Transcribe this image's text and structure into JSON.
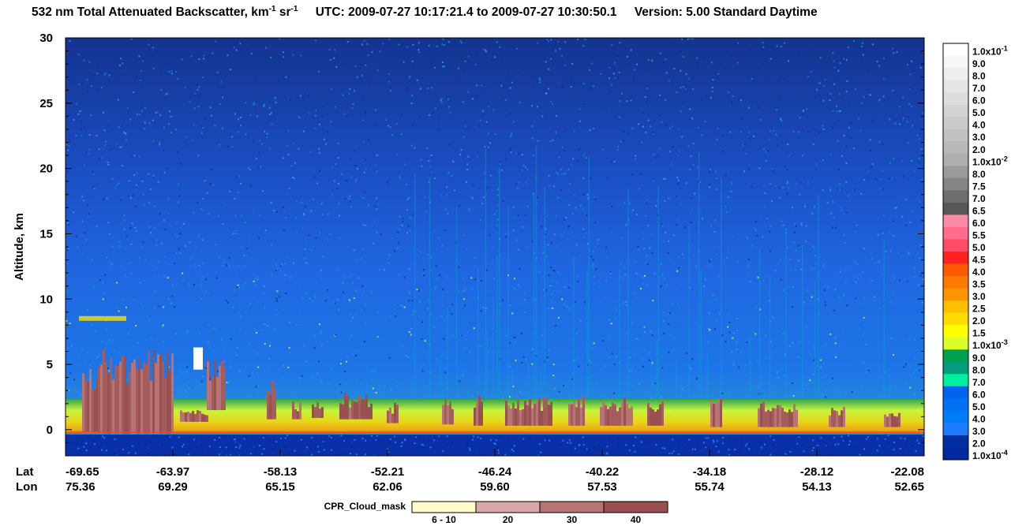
{
  "title": {
    "main": "532 nm Total Attenuated Backscatter, km",
    "unit_exp1": "-1",
    "unit_mid": " sr",
    "unit_exp2": "-1",
    "utc_label": "UTC:",
    "start_time": "2009-07-27 10:17:21.4",
    "to_word": "to",
    "end_time": "2009-07-27 10:30:50.1",
    "version": "Version: 5.00",
    "product": "Standard",
    "daytime": "Daytime"
  },
  "chart_data": {
    "type": "heatmap",
    "ylabel": "Altitude, km",
    "ylim": [
      -2,
      30
    ],
    "y_ticks": [
      "0",
      "5",
      "10",
      "15",
      "20",
      "25",
      "30"
    ],
    "y_tick_values": [
      0,
      5,
      10,
      15,
      20,
      25,
      30
    ],
    "x_row_labels": [
      "Lat",
      "Lon"
    ],
    "lat_ticks": [
      "-69.65",
      "-63.97",
      "-58.13",
      "-52.21",
      "-46.24",
      "-40.22",
      "-34.18",
      "-28.12",
      "-22.08"
    ],
    "lon_ticks": [
      "75.36",
      "69.29",
      "65.15",
      "62.06",
      "59.60",
      "57.53",
      "55.74",
      "54.13",
      "52.65"
    ],
    "grid": false,
    "colorbar": {
      "placement": "right",
      "labels": [
        "1.0x10-1",
        "9.0",
        "8.0",
        "7.0",
        "6.0",
        "5.0",
        "4.0",
        "3.0",
        "2.0",
        "1.0x10-2",
        "8.0",
        "7.5",
        "7.0",
        "6.5",
        "6.0",
        "5.5",
        "5.0",
        "4.5",
        "4.0",
        "3.5",
        "3.0",
        "2.5",
        "2.0",
        "1.5",
        "1.0x10-3",
        "9.0",
        "8.0",
        "7.0",
        "6.0",
        "5.0",
        "4.0",
        "3.0",
        "2.0",
        "1.0x10-4"
      ],
      "colors": [
        "#ffffff",
        "#f7f7f7",
        "#eeeeee",
        "#e6e6e6",
        "#dddddd",
        "#d4d4d4",
        "#cbcbcb",
        "#c2c2c2",
        "#b9b9b9",
        "#afafaf",
        "#9a9a9a",
        "#858585",
        "#6e6e6e",
        "#575757",
        "#ff8aa8",
        "#ff6c8c",
        "#ff4a68",
        "#ff2020",
        "#ff5a00",
        "#ff7800",
        "#ff9600",
        "#ffbe00",
        "#ffdc00",
        "#ffff00",
        "#d8ff2a",
        "#00a050",
        "#009e7e",
        "#00f0a0",
        "#0064f0",
        "#0070f4",
        "#007cf8",
        "#1e7cff",
        "#0030a0",
        "#0028a0"
      ]
    },
    "cpr_cloud_mask": {
      "label": "CPR_Cloud_mask",
      "bins": [
        "6 - 10",
        "20",
        "30",
        "40"
      ],
      "colors": [
        "#fffcc8",
        "#d9a8a8",
        "#b87474",
        "#985050"
      ]
    }
  }
}
